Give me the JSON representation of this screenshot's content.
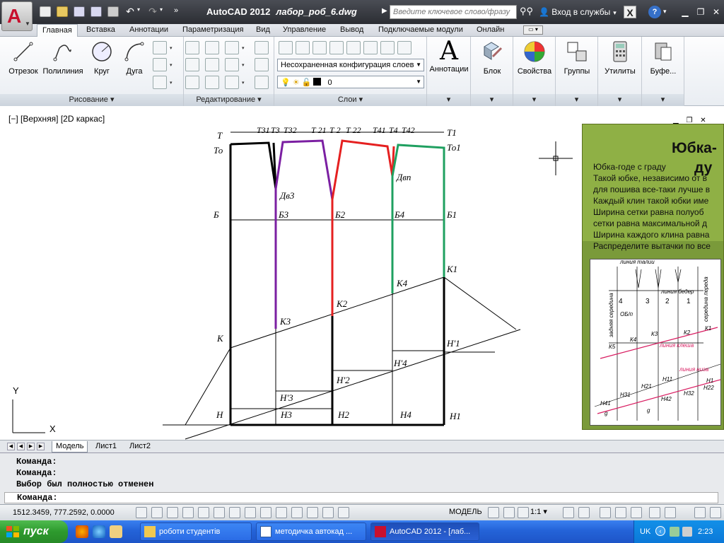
{
  "title_bar": {
    "app_name": "AutoCAD 2012",
    "file_name": "лабор_роб_6.dwg",
    "search_placeholder": "Введите ключевое слово/фразу",
    "sign_in": "Вход в службы"
  },
  "tabs": [
    "Главная",
    "Вставка",
    "Аннотации",
    "Параметризация",
    "Вид",
    "Управление",
    "Вывод",
    "Подключаемые модули",
    "Онлайн"
  ],
  "ribbon": {
    "draw": {
      "title": "Рисование",
      "tools": [
        "Отрезок",
        "Полилиния",
        "Круг",
        "Дуга"
      ]
    },
    "modify": {
      "title": "Редактирование"
    },
    "layers": {
      "title": "Слои",
      "layer_state": "Несохраненная конфигурация слоев",
      "current_layer": "0"
    },
    "big_buttons": [
      "Аннотации",
      "Блок",
      "Свойства",
      "Группы",
      "Утилиты",
      "Буфе..."
    ]
  },
  "viewport": {
    "label": "[−] [Верхняя] [2D каркас]",
    "ucs_x": "X",
    "ucs_y": "Y"
  },
  "drawing_labels": {
    "T": "Т",
    "To": "То",
    "T31": "Т31",
    "T3": "Т3",
    "T32": "Т32",
    "T21": "Т 21",
    "T2": "Т 2",
    "T22": "Т 22",
    "T41": "Т41",
    "T4": "Т4",
    "T42": "Т42",
    "T1": "Т1",
    "To1": "То1",
    "Dv3": "Дв3",
    "Dvp": "Двп",
    "B": "Б",
    "B3": "Б3",
    "B2": "Б2",
    "B4": "Б4",
    "B1": "Б1",
    "K1": "К1",
    "K4": "К4",
    "K2": "К2",
    "K3": "К3",
    "K": "К",
    "H1p": "Н'1",
    "H4p": "Н'4",
    "H2p": "Н'2",
    "H3p": "Н'3",
    "H": "Н",
    "H3": "Н3",
    "H2": "Н2",
    "H4": "Н4",
    "H1": "Н1"
  },
  "image_panel": {
    "heading1": "Юбка-",
    "heading2": "ду",
    "lines": [
      "Юбка-годе с граду",
      "Такой юбке, независимо от в",
      "для пошива все-таки лучше в",
      "Каждый клин такой юбки име",
      "Ширина сетки равна полуоб",
      "сетки равна максимальной д",
      "Ширина каждого клина равна",
      "Распределите вытачки по все"
    ],
    "sketch": {
      "waist": "линия талии",
      "hips": "линия бедер",
      "back": "задняя середина",
      "front": "середина переда",
      "flare": "линия клеша",
      "hem": "линия низа",
      "cols": [
        "4",
        "3",
        "2",
        "1"
      ],
      "ob": "ОБ/п",
      "labels": [
        "К5",
        "К4",
        "К3",
        "К2",
        "К1",
        "Н41",
        "Н31",
        "Н21",
        "Н11",
        "Н1",
        "Н32",
        "Н22",
        "Н42",
        "g",
        "g"
      ]
    }
  },
  "model_tabs": [
    "Модель",
    "Лист1",
    "Лист2"
  ],
  "command_line": {
    "history": [
      "Команда:",
      "Команда:",
      "Выбор был полностью отменен"
    ],
    "prompt": "Команда:"
  },
  "status": {
    "coords": "1512.3459, 777.2592, 0.0000",
    "model": "МОДЕЛЬ",
    "scale": "1:1"
  },
  "taskbar": {
    "start": "пуск",
    "tasks": [
      "роботи студентів",
      "методичка автокад ...",
      "AutoCAD 2012 - [лаб..."
    ],
    "lang": "UK",
    "clock": "2:23"
  }
}
